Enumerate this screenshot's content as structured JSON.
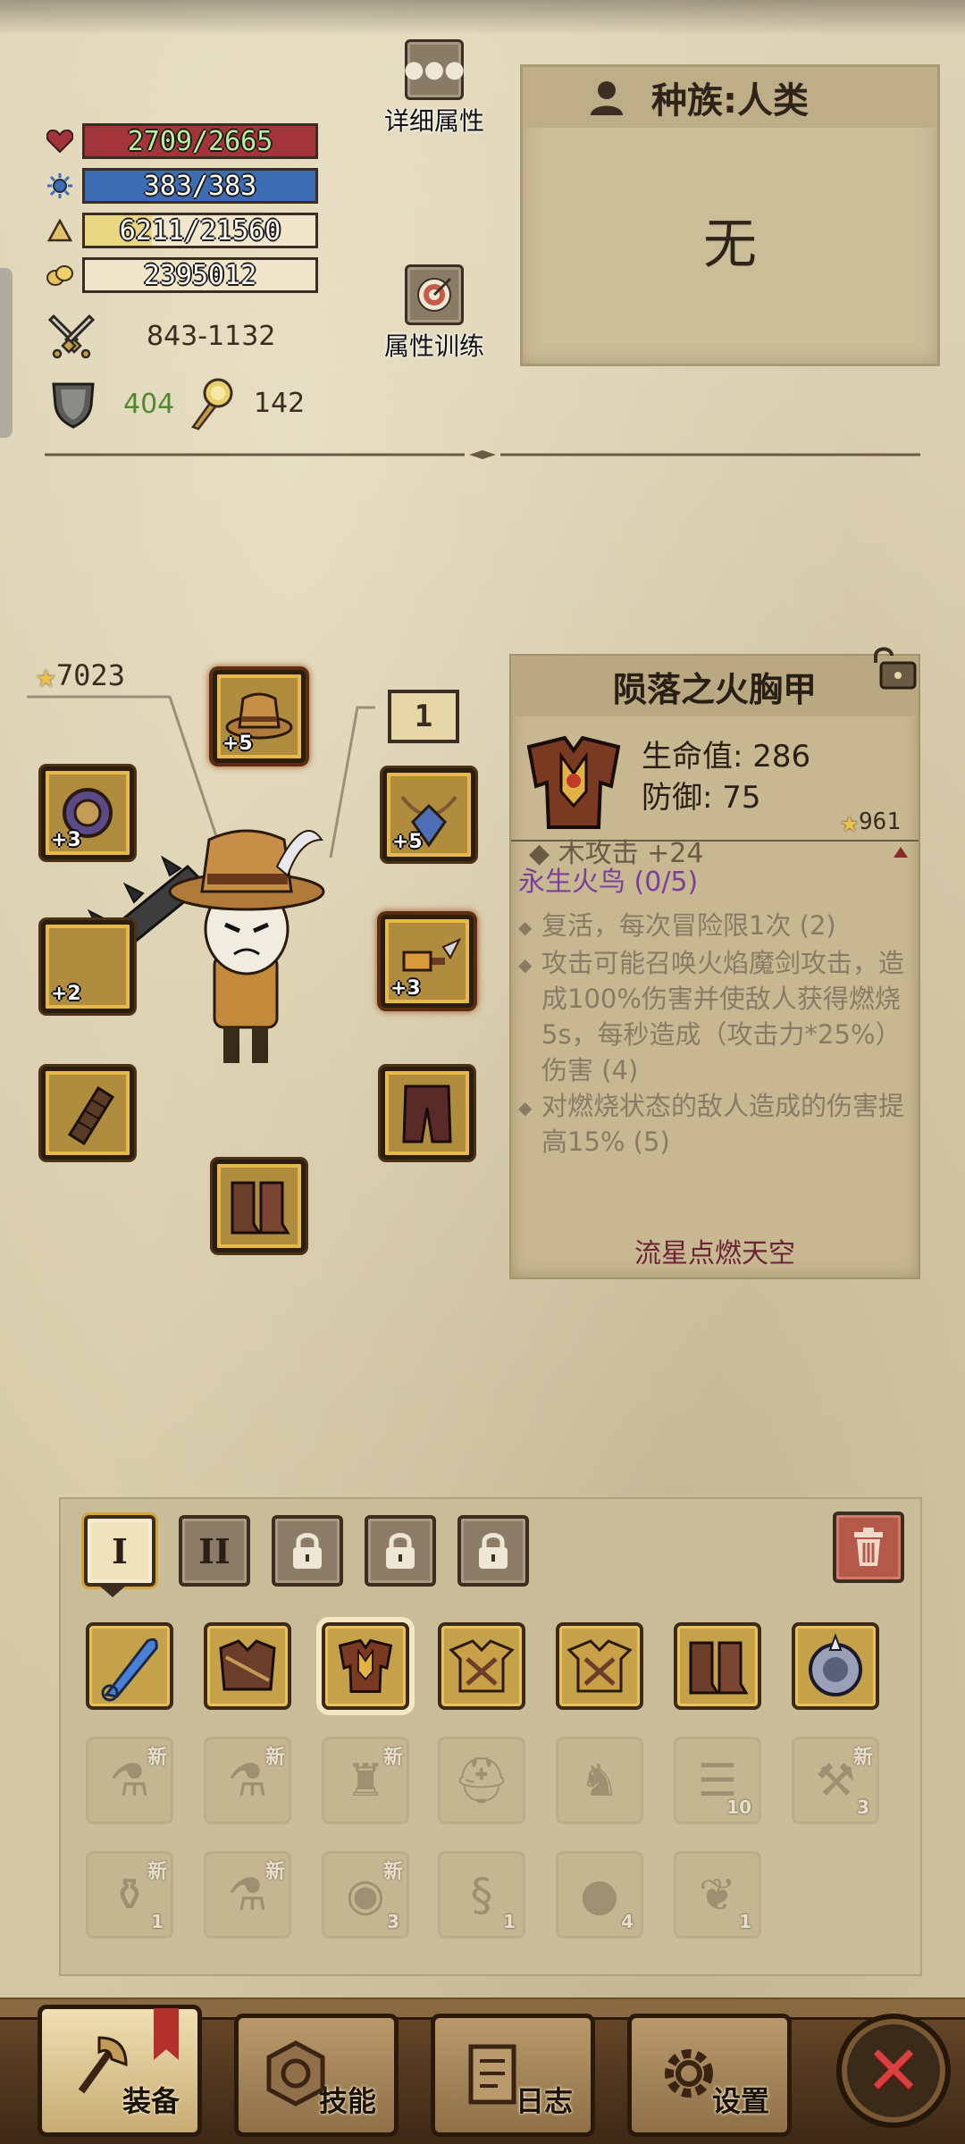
{
  "stats": {
    "hp": "2709/2665",
    "mp": "383/383",
    "exp": "6211/21560",
    "gold": "2395012",
    "attack": "843-1132",
    "defense": "404",
    "crit": "142"
  },
  "buttons": {
    "details": "详细属性",
    "training": "属性训练"
  },
  "race": {
    "title": "种族:人类",
    "value": "无"
  },
  "character": {
    "power": "7023",
    "level": "1"
  },
  "equip_slots": [
    {
      "name": "head",
      "enh": "+5"
    },
    {
      "name": "amulet",
      "enh": "+5"
    },
    {
      "name": "left-accessory",
      "enh": "+3"
    },
    {
      "name": "weapon",
      "enh": "+2"
    },
    {
      "name": "offhand",
      "enh": "+3"
    },
    {
      "name": "gloves",
      "enh": ""
    },
    {
      "name": "pants",
      "enh": ""
    },
    {
      "name": "boots",
      "enh": ""
    }
  ],
  "tooltip": {
    "title": "陨落之火胸甲",
    "stat1": "生命值: 286",
    "stat2": "防御: 75",
    "star": "961",
    "cut_line": "◆ 木攻击 +24",
    "set_name": "永生火鸟 (0/5)",
    "effects": [
      "复活，每次冒险限1次 (2)",
      "攻击可能召唤火焰魔剑攻击，造成100%伤害并使敌人获得燃烧5s，每秒造成（攻击力*25%）伤害 (4)",
      "对燃烧状态的敌人造成的伤害提高15% (5)"
    ],
    "footer": "流星点燃天空"
  },
  "inventory": {
    "tabs": [
      "I",
      "II"
    ],
    "locked_tabs": 3,
    "row2_qty": [
      "",
      "",
      "",
      "",
      "",
      "10",
      "3"
    ],
    "row3_qty": [
      "1",
      "",
      "3",
      "1",
      "4",
      "1",
      ""
    ],
    "new_badge": "新"
  },
  "nav": {
    "equip": "装备",
    "skills": "技能",
    "log": "日志",
    "settings": "设置"
  },
  "colors": {
    "hp_bar": "#a3343c",
    "mp_bar": "#3c6cb4",
    "exp_bar": "#e8d682",
    "gold_bar": "#efe6cc",
    "set_purple": "#7a3f9a",
    "close_red": "#d94040"
  }
}
